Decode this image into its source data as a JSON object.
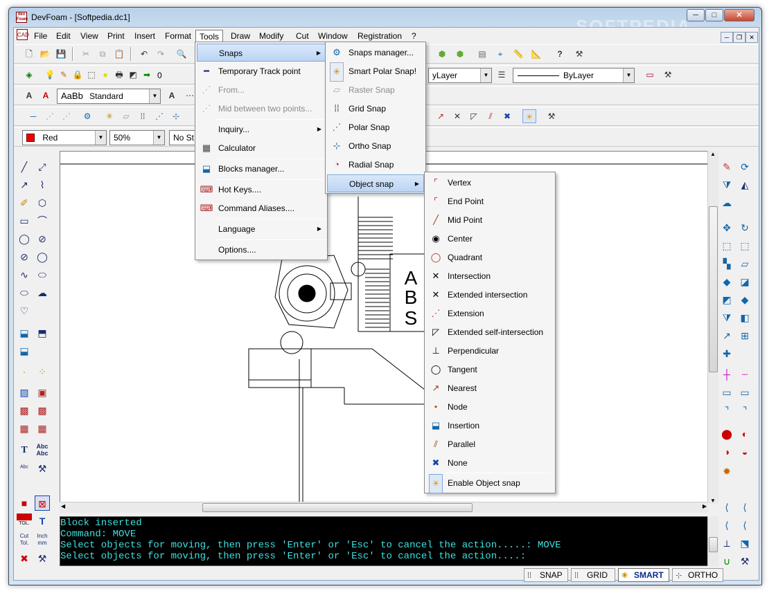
{
  "window": {
    "title": "DevFoam - [Softpedia.dc1]",
    "icon_text": "dev Foam",
    "watermark": "SOFTPEDIA"
  },
  "menubar": [
    "File",
    "Edit",
    "View",
    "Print",
    "Insert",
    "Format",
    "Tools",
    "Draw",
    "Modify",
    "Cut",
    "Window",
    "Registration",
    "?"
  ],
  "toolbar": {
    "layer_value": "0",
    "linetype_layer": "yLayer",
    "lineweight_layer": "ByLayer",
    "text_style": "Standard",
    "text_style_sample": "AaBb",
    "color_value": "Red",
    "zoom_value": "50%",
    "style_value": "No St"
  },
  "tools_menu": {
    "items": [
      {
        "label": "Snaps",
        "submenu": true,
        "highlighted": true,
        "icon": "snaps-icon"
      },
      {
        "label": "Temporary Track point",
        "icon": "track-point-icon"
      },
      {
        "label": "From...",
        "disabled": true,
        "icon": "from-icon"
      },
      {
        "label": "Mid between two points...",
        "disabled": true,
        "icon": "mid-between-icon"
      },
      {
        "label": "Inquiry...",
        "submenu": true,
        "icon": ""
      },
      {
        "label": "Calculator",
        "icon": "calculator-icon"
      },
      {
        "label": "Blocks manager...",
        "icon": "blocks-manager-icon"
      },
      {
        "label": "Hot Keys....",
        "icon": "hot-keys-icon"
      },
      {
        "label": "Command Aliases....",
        "icon": "command-aliases-icon"
      },
      {
        "label": "Language",
        "submenu": true,
        "icon": ""
      },
      {
        "label": "Options....",
        "icon": ""
      }
    ]
  },
  "snaps_menu": {
    "items": [
      {
        "label": "Snaps manager...",
        "icon": "snaps-manager-icon"
      },
      {
        "label": "Smart Polar Snap!",
        "icon": "smart-polar-icon"
      },
      {
        "label": "Raster Snap",
        "disabled": true,
        "icon": "raster-snap-icon"
      },
      {
        "label": "Grid Snap",
        "icon": "grid-snap-icon"
      },
      {
        "label": "Polar Snap",
        "icon": "polar-snap-icon"
      },
      {
        "label": "Ortho Snap",
        "icon": "ortho-snap-icon"
      },
      {
        "label": "Radial Snap",
        "icon": "radial-snap-icon"
      },
      {
        "label": "Object snap",
        "highlighted": true,
        "submenu": true,
        "icon": ""
      }
    ]
  },
  "object_snap_menu": {
    "items": [
      {
        "label": "Vertex",
        "icon": "vertex-icon"
      },
      {
        "label": "End Point",
        "icon": "end-point-icon"
      },
      {
        "label": "Mid Point",
        "icon": "mid-point-icon"
      },
      {
        "label": "Center",
        "icon": "center-icon"
      },
      {
        "label": "Quadrant",
        "icon": "quadrant-icon"
      },
      {
        "label": "Intersection",
        "icon": "intersection-icon"
      },
      {
        "label": "Extended intersection",
        "icon": "extended-intersection-icon"
      },
      {
        "label": "Extension",
        "icon": "extension-icon"
      },
      {
        "label": "Extended self-intersection",
        "icon": "self-intersection-icon"
      },
      {
        "label": "Perpendicular",
        "icon": "perpendicular-icon"
      },
      {
        "label": "Tangent",
        "icon": "tangent-icon"
      },
      {
        "label": "Nearest",
        "icon": "nearest-icon"
      },
      {
        "label": "Node",
        "icon": "node-icon"
      },
      {
        "label": "Insertion",
        "icon": "insertion-icon"
      },
      {
        "label": "Parallel",
        "icon": "parallel-icon"
      },
      {
        "label": "None",
        "icon": "none-icon"
      },
      {
        "label": "Enable Object snap",
        "icon": "enable-snap-icon"
      }
    ]
  },
  "drawing": {
    "abs_text": [
      "A",
      "B",
      "S"
    ]
  },
  "left_tools": {
    "text_tool": "T",
    "abc_tool": "Abc",
    "tol_label": "TOL.",
    "cut_tol": "Cut Tol.",
    "inch_mm": "Inch mm"
  },
  "console": [
    "Block inserted",
    "Command: MOVE",
    "Select objects for moving, then press 'Enter' or 'Esc' to cancel the action.....: MOVE",
    "Select objects for moving, then press 'Enter' or 'Esc' to cancel the action....:"
  ],
  "statusbar": {
    "snap": "SNAP",
    "grid": "GRID",
    "smart": "SMART",
    "ortho": "ORTHO"
  },
  "colors": {
    "accent": "#3399ff",
    "console_bg": "#000000",
    "console_fg": "#3ee0e0",
    "menu_highlight": "#cce0f7"
  }
}
